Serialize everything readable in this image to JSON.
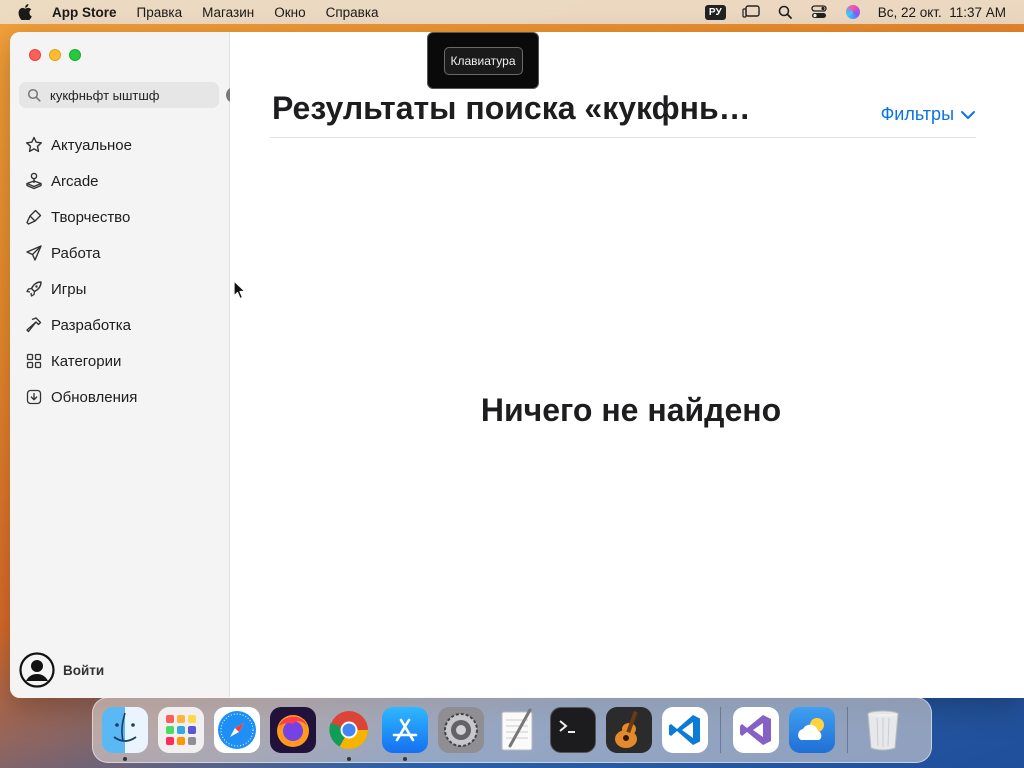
{
  "menubar": {
    "app_name": "App Store",
    "items": [
      "Правка",
      "Магазин",
      "Окно",
      "Справка"
    ],
    "input_lang": "РУ",
    "datetime": "Вс, 22 окт.  11:37 AM"
  },
  "tooltip": {
    "label": "Клавиатура"
  },
  "search": {
    "value": "кукфньфт ыштшф"
  },
  "sidebar": {
    "items": [
      {
        "label": "Актуальное",
        "icon": "star-icon"
      },
      {
        "label": "Arcade",
        "icon": "joystick-icon"
      },
      {
        "label": "Творчество",
        "icon": "paintbrush-icon"
      },
      {
        "label": "Работа",
        "icon": "paperplane-icon"
      },
      {
        "label": "Игры",
        "icon": "rocket-icon"
      },
      {
        "label": "Разработка",
        "icon": "hammer-icon"
      },
      {
        "label": "Категории",
        "icon": "grid-icon"
      },
      {
        "label": "Обновления",
        "icon": "download-icon"
      }
    ],
    "signin_label": "Войти"
  },
  "main": {
    "title": "Результаты поиска «кукфнь…",
    "filters_label": "Фильтры",
    "empty_message": "Ничего не найдено"
  },
  "dock": {
    "apps": [
      {
        "name": "finder-icon",
        "running": true
      },
      {
        "name": "launchpad-icon",
        "running": false
      },
      {
        "name": "safari-icon",
        "running": false
      },
      {
        "name": "firefox-icon",
        "running": false
      },
      {
        "name": "chrome-icon",
        "running": true
      },
      {
        "name": "app-store-icon",
        "running": true
      },
      {
        "name": "system-settings-icon",
        "running": false
      },
      {
        "name": "textedit-icon",
        "running": false
      },
      {
        "name": "terminal-icon",
        "running": false
      },
      {
        "name": "garageband-icon",
        "running": false
      },
      {
        "name": "vscode-icon",
        "running": false
      },
      {
        "name": "visual-studio-icon",
        "running": false
      },
      {
        "name": "weather-icon",
        "running": false
      },
      {
        "name": "trash-icon",
        "running": false
      }
    ]
  },
  "colors": {
    "accent": "#0a74e5"
  }
}
